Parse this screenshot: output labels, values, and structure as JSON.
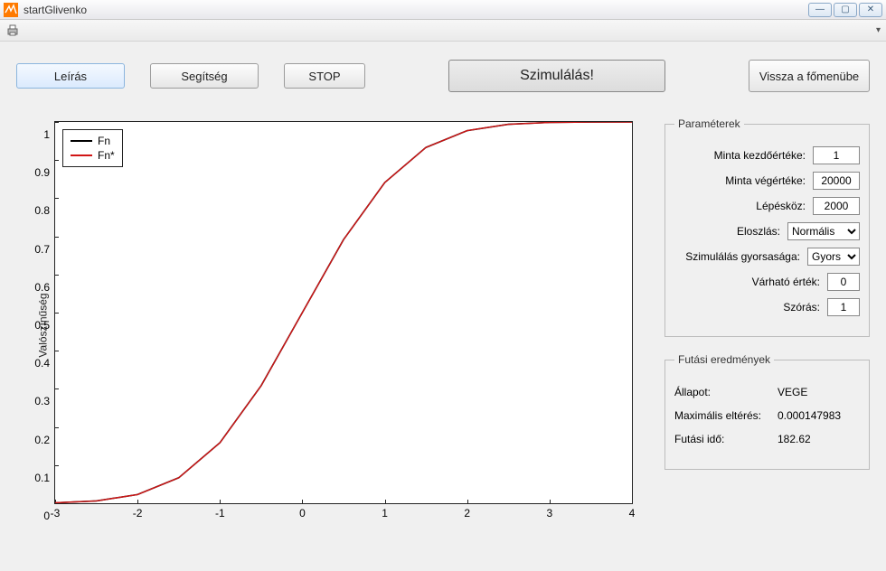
{
  "window": {
    "title": "startGlivenko",
    "icons": {
      "minimize": "—",
      "maximize": "▢",
      "close": "✕"
    }
  },
  "buttons": {
    "desc": "Leírás",
    "help": "Segítség",
    "stop": "STOP",
    "sim": "Szimulálás!",
    "back": "Vissza a főmenübe"
  },
  "chart_data": {
    "type": "line",
    "title": "",
    "xlabel": "",
    "ylabel": "Valószínűség",
    "xlim": [
      -3,
      4
    ],
    "ylim": [
      0,
      1
    ],
    "xticks": [
      -3,
      -2,
      -1,
      0,
      1,
      2,
      3,
      4
    ],
    "yticks": [
      0,
      0.1,
      0.2,
      0.3,
      0.4,
      0.5,
      0.6,
      0.7,
      0.8,
      0.9,
      1
    ],
    "legend": [
      {
        "name": "Fn",
        "color": "#000000"
      },
      {
        "name": "Fn*",
        "color": "#d11515"
      }
    ],
    "series": [
      {
        "name": "Fn",
        "color": "#000000",
        "x": [
          -3,
          -2.5,
          -2,
          -1.5,
          -1,
          -0.5,
          0,
          0.5,
          1,
          1.5,
          2,
          2.5,
          3,
          3.5,
          4
        ],
        "y": [
          0.0013,
          0.0062,
          0.0228,
          0.0668,
          0.1587,
          0.3085,
          0.5,
          0.6915,
          0.8413,
          0.9332,
          0.9772,
          0.9938,
          0.9987,
          0.9998,
          1
        ]
      },
      {
        "name": "Fn*",
        "color": "#d11515",
        "x": [
          -3,
          -2.5,
          -2,
          -1.5,
          -1,
          -0.5,
          0,
          0.5,
          1,
          1.5,
          2,
          2.5,
          3,
          3.5,
          4
        ],
        "y": [
          0.0013,
          0.0062,
          0.0228,
          0.0668,
          0.1587,
          0.3085,
          0.5,
          0.6915,
          0.8413,
          0.9332,
          0.9772,
          0.9938,
          0.9987,
          0.9998,
          1
        ]
      }
    ]
  },
  "params_legend": "Paraméterek",
  "params": {
    "start_label": "Minta kezdőértéke:",
    "start_value": "1",
    "end_label": "Minta végértéke:",
    "end_value": "20000",
    "step_label": "Lépésköz:",
    "step_value": "2000",
    "dist_label": "Eloszlás:",
    "dist_value": "Normális",
    "speed_label": "Szimulálás gyorsasága:",
    "speed_value": "Gyors",
    "mean_label": "Várható érték:",
    "mean_value": "0",
    "std_label": "Szórás:",
    "std_value": "1"
  },
  "results_legend": "Futási eredmények",
  "results": {
    "state_label": "Állapot:",
    "state_value": "VEGE",
    "maxdev_label": "Maximális eltérés:",
    "maxdev_value": "0.000147983",
    "time_label": "Futási idő:",
    "time_value": "182.62"
  }
}
